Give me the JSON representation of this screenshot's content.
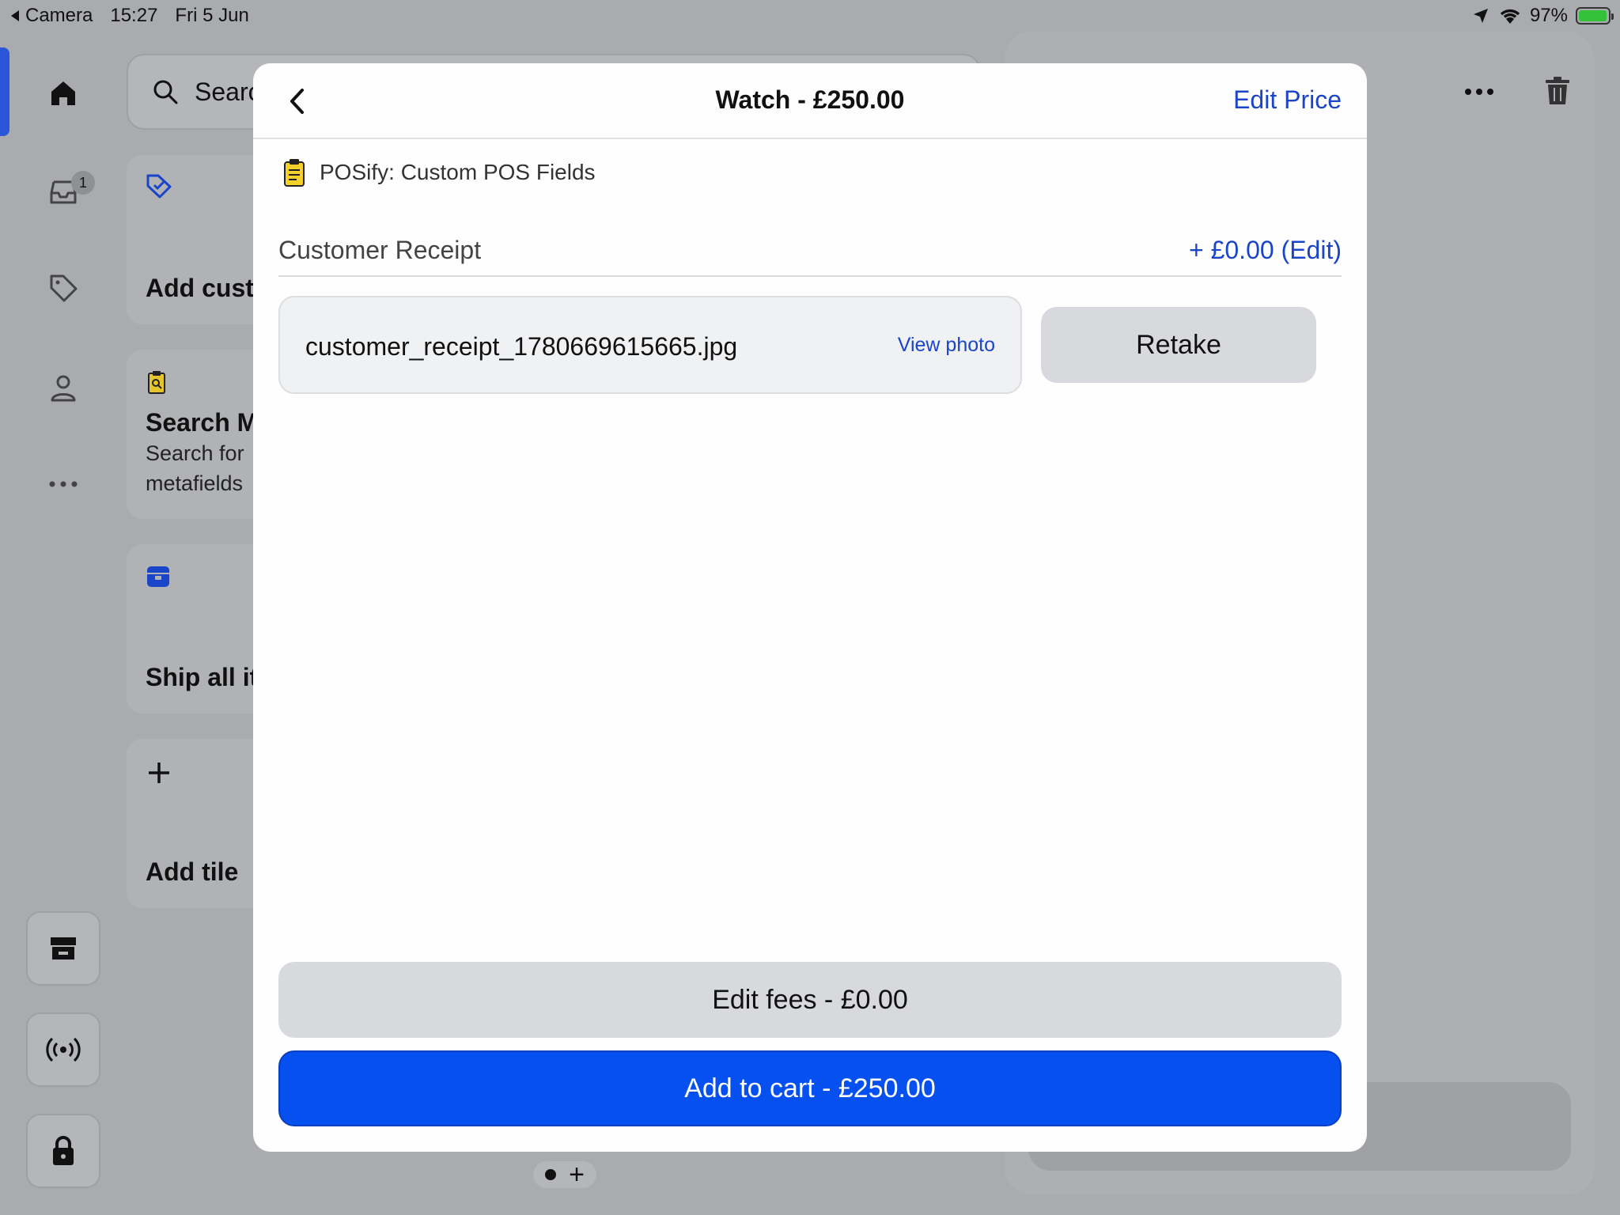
{
  "status_bar": {
    "back_app": "Camera",
    "time": "15:27",
    "date": "Fri 5 Jun",
    "battery": "97%",
    "battery_level": 0.97
  },
  "background": {
    "search_placeholder": "Search",
    "tiles": [
      {
        "title": "Add customer"
      },
      {
        "title": "Search Metafields",
        "subtitle_1": "Search for",
        "subtitle_2": "metafields"
      },
      {
        "title": "Ship all items"
      },
      {
        "title": "Add tile"
      }
    ],
    "rail_badge": "1"
  },
  "modal": {
    "title": "Watch - £250.00",
    "edit_price_label": "Edit Price",
    "app_name": "POSify: Custom POS Fields",
    "field_label": "Customer Receipt",
    "field_edit": "+ £0.00 (Edit)",
    "file_name": "customer_receipt_1780669615665.jpg",
    "view_photo_label": "View photo",
    "retake_label": "Retake",
    "fees_label": "Edit fees - £0.00",
    "cart_label": "Add to cart - £250.00"
  },
  "colors": {
    "accent_blue": "#0550ee",
    "link_blue": "#1a45c9",
    "battery_green": "#33c23a"
  }
}
